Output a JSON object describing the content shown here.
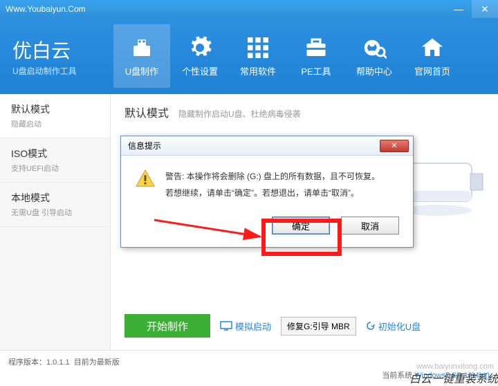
{
  "url": "Www.Youbaiyun.Com",
  "brand": {
    "name": "优白云",
    "sub": "U盘启动制作工具"
  },
  "nav": [
    {
      "label": "U盘制作"
    },
    {
      "label": "个性设置"
    },
    {
      "label": "常用软件"
    },
    {
      "label": "PE工具"
    },
    {
      "label": "帮助中心"
    },
    {
      "label": "官网首页"
    }
  ],
  "sidebar": [
    {
      "title": "默认模式",
      "sub": "隐藏启动"
    },
    {
      "title": "ISO模式",
      "sub": "支持UEFI启动"
    },
    {
      "title": "本地模式",
      "sub": "无需U盘 引导启动"
    }
  ],
  "main": {
    "title": "默认模式",
    "sub": "隐藏制作启动U盘、杜绝病毒侵袭"
  },
  "actions": {
    "start": "开始制作",
    "simulate": "模拟启动",
    "repair": "修复G:引导 MBR",
    "init": "初始化U盘"
  },
  "footer": {
    "ver_label": "程序版本：",
    "ver": "1.0.1.1",
    "ver_note": "目前为最新版",
    "sys_label": "当前系统",
    "sys": "Windows7 SP 1(64bit)",
    "wm": "白云一键重装系统",
    "wu": "www.baiyunxitong.com"
  },
  "dialog": {
    "title": "信息提示",
    "line1": "警告: 本操作将会删除 (G:) 盘上的所有数据，且不可恢复。",
    "line2": "若想继续，请单击“确定”。若想退出，请单击“取消”。",
    "ok": "确定",
    "cancel": "取消"
  }
}
